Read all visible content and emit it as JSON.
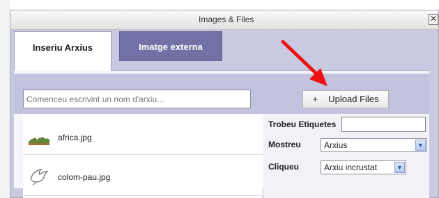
{
  "dialog": {
    "title": "Images & Files",
    "close_glyph": "✕"
  },
  "tabs": [
    {
      "label": "Inseriu Arxius",
      "active": true
    },
    {
      "label": "Imatge externa",
      "active": false
    }
  ],
  "search": {
    "placeholder": "Comenceu escrivint un nom d'arxiu..."
  },
  "upload": {
    "icon": "plus-icon",
    "glyph": "+",
    "label": "Upload Files"
  },
  "files": [
    {
      "name": "africa.jpg",
      "thumb_icon": "landscape-thumbnail-icon"
    },
    {
      "name": "colom-pau.jpg",
      "thumb_icon": "dove-thumbnail-icon"
    }
  ],
  "options": {
    "tags_label": "Trobeu Etiquetes",
    "tags_value": "",
    "show_label": "Mostreu",
    "show_value": "Arxius",
    "click_label": "Cliqueu",
    "click_value": "Arxiu incrustat"
  },
  "colors": {
    "annotation_arrow": "#ee1111",
    "inactive_tab": "#7171a6",
    "panel_header": "#c3c3e0"
  },
  "annotation": {
    "arrow_icon": "red-arrow-annotation"
  }
}
